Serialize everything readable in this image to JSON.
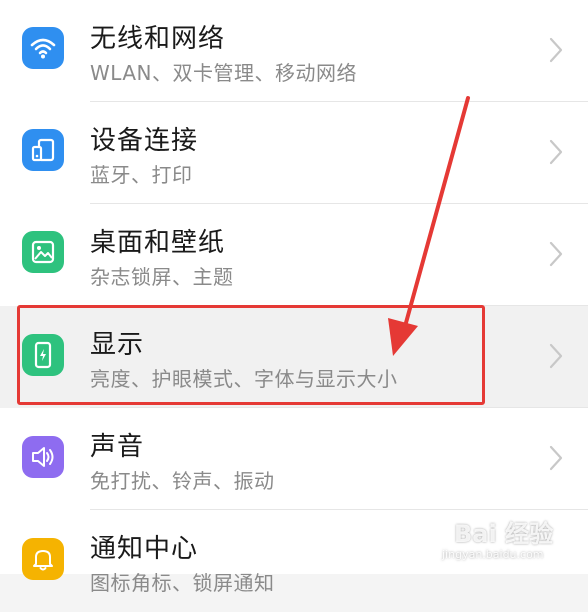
{
  "settings": {
    "items": [
      {
        "title": "无线和网络",
        "subtitle": "WLAN、双卡管理、移动网络",
        "icon": "wifi-icon",
        "icon_color": "#2f8ff0"
      },
      {
        "title": "设备连接",
        "subtitle": "蓝牙、打印",
        "icon": "device-connection-icon",
        "icon_color": "#2f8ff0"
      },
      {
        "title": "桌面和壁纸",
        "subtitle": "杂志锁屏、主题",
        "icon": "wallpaper-icon",
        "icon_color": "#2ec27e"
      },
      {
        "title": "显示",
        "subtitle": "亮度、护眼模式、字体与显示大小",
        "icon": "display-icon",
        "icon_color": "#2ec27e"
      },
      {
        "title": "声音",
        "subtitle": "免打扰、铃声、振动",
        "icon": "sound-icon",
        "icon_color": "#8e6cf0"
      },
      {
        "title": "通知中心",
        "subtitle": "图标角标、锁屏通知",
        "icon": "notification-bell-icon",
        "icon_color": "#f5b301"
      }
    ]
  },
  "annotation": {
    "color": "#e53935",
    "highlighted_item": "显示"
  },
  "watermark": {
    "brand": "Bai 经验",
    "url": "jingyan.baidu.com"
  }
}
